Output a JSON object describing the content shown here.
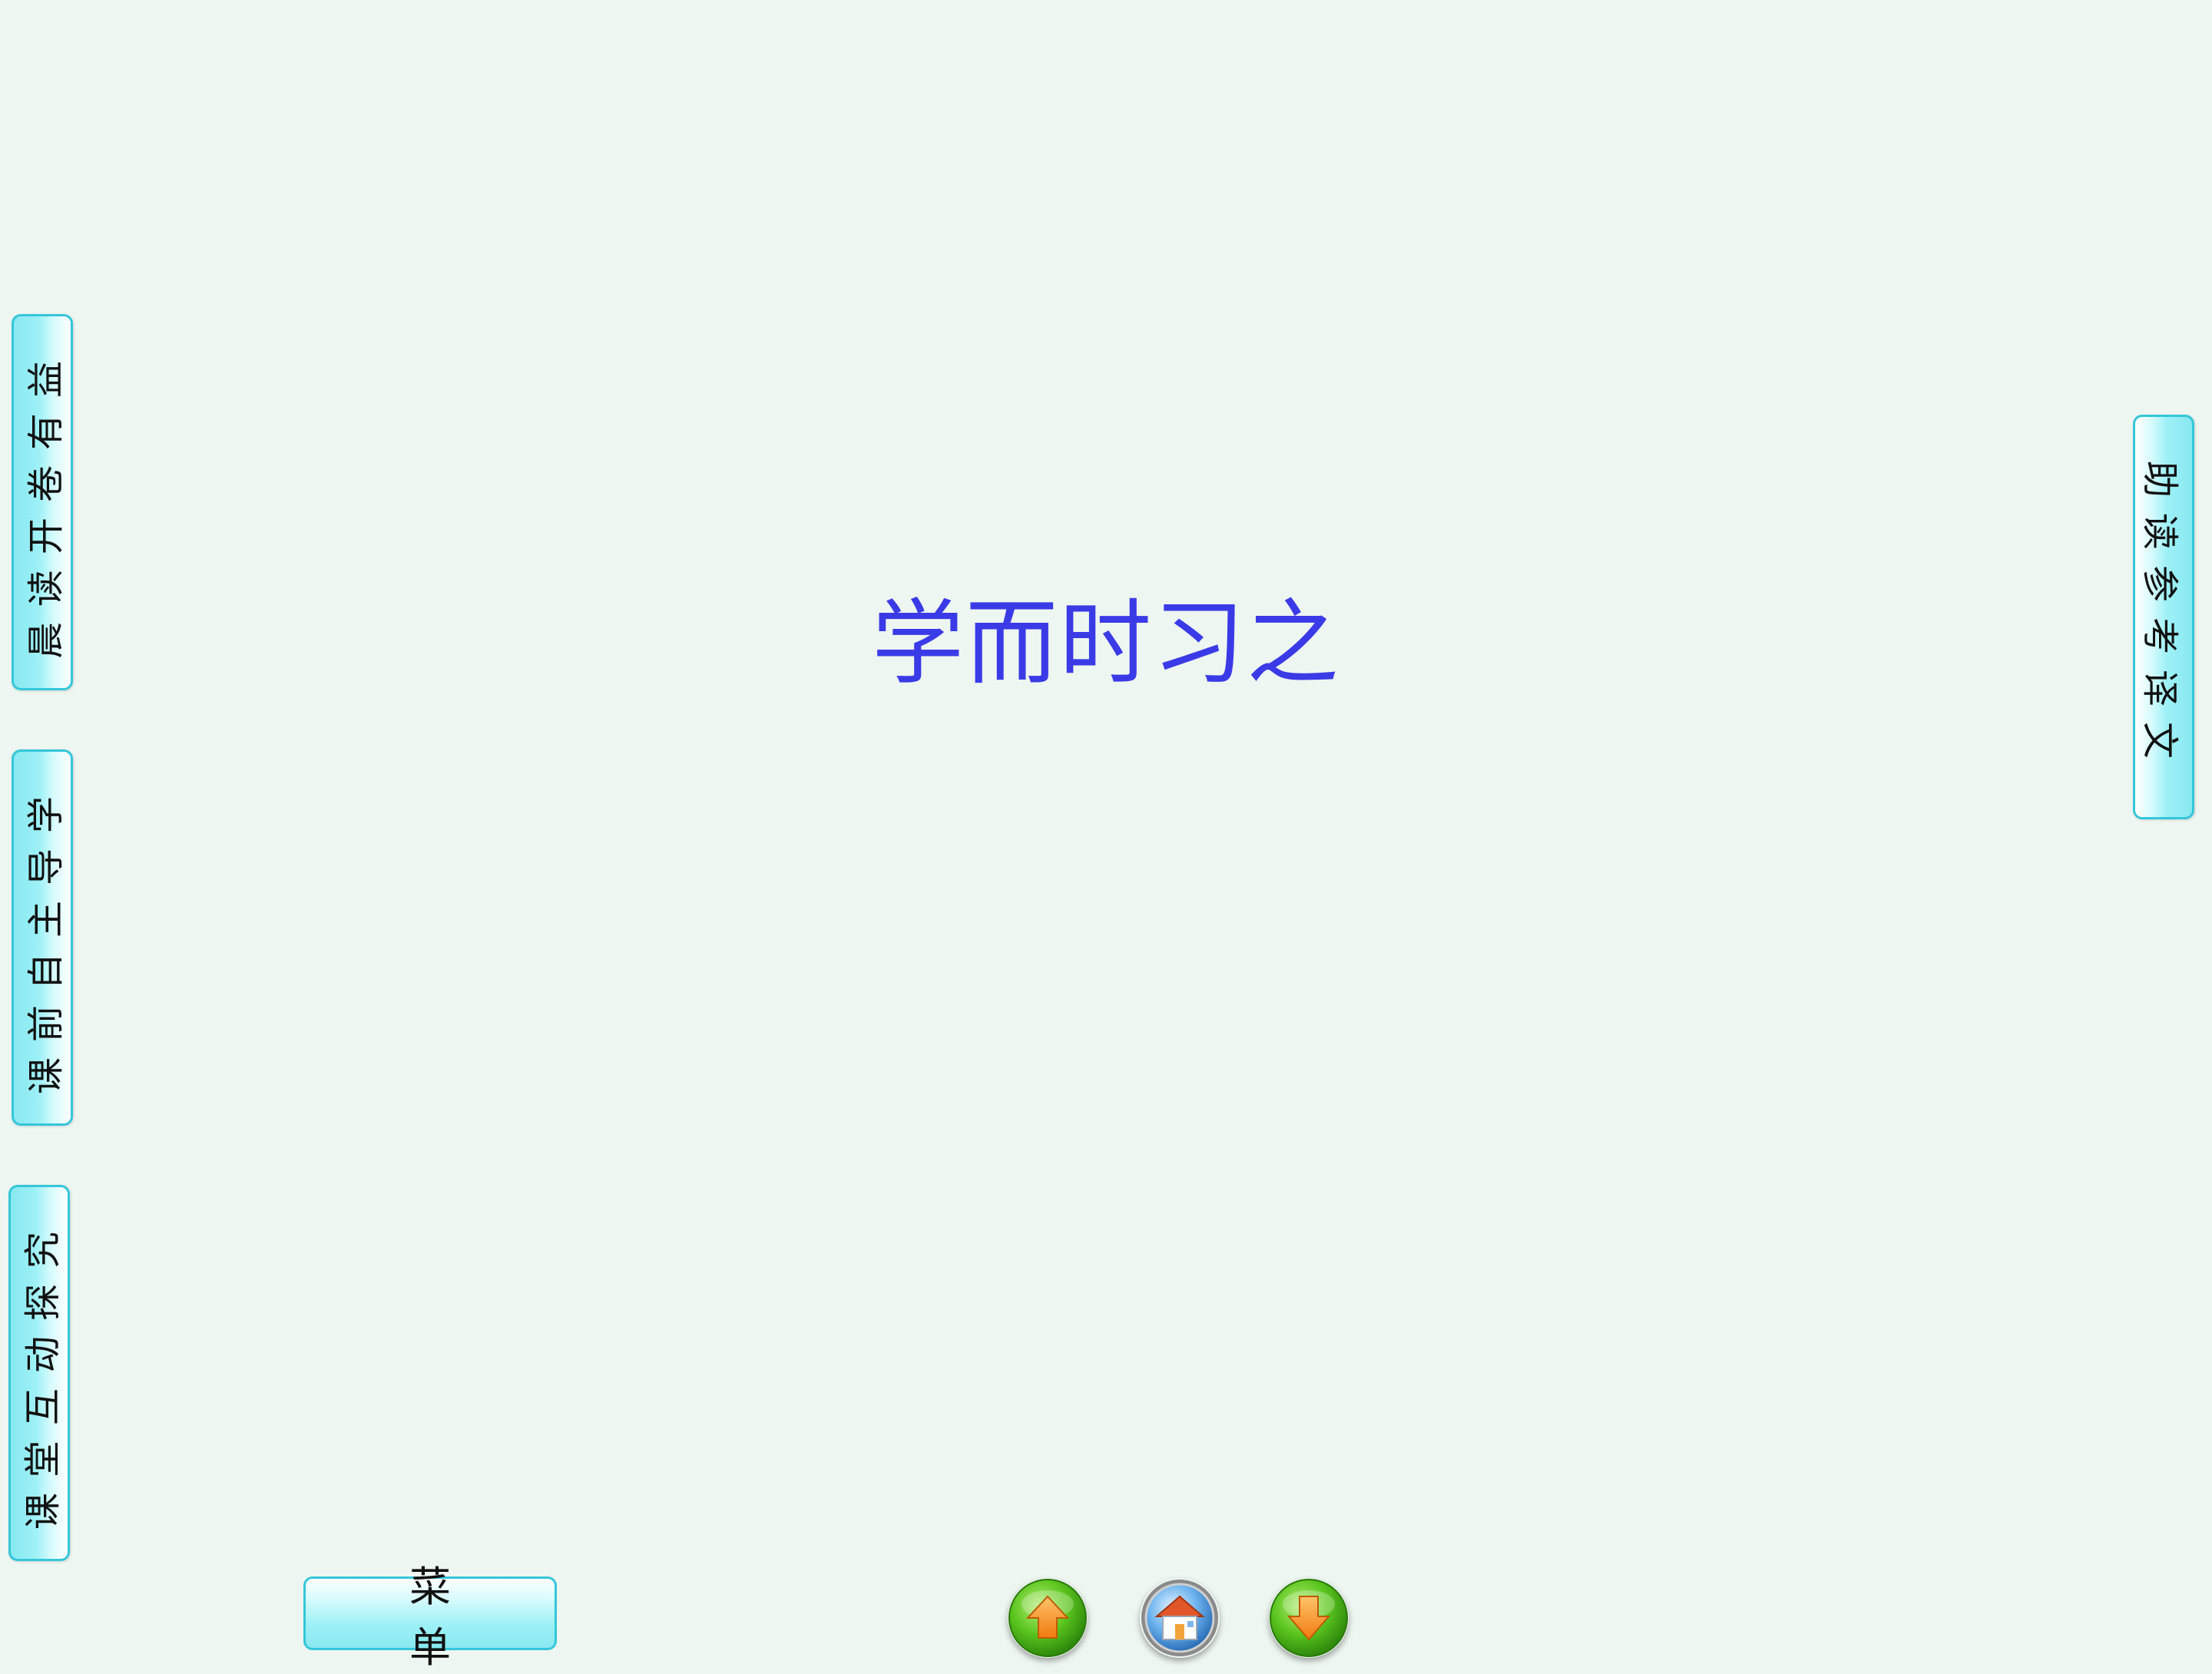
{
  "slide": {
    "title": "学而时习之"
  },
  "side_tabs": {
    "morning_reading": "晨读开卷有益",
    "preclass": "课前自主导学",
    "interactive": "课堂互动探究",
    "reading_aid": "助读参考译文"
  },
  "menu": {
    "label": "菜单"
  },
  "nav_icons": {
    "prev": "up-arrow-icon",
    "home": "home-icon",
    "next": "down-arrow-icon"
  },
  "colors": {
    "background": "#eef6f1",
    "title": "#3a3be6",
    "tab_border": "#35c6da",
    "tab_fill": "#9ef1f7"
  }
}
